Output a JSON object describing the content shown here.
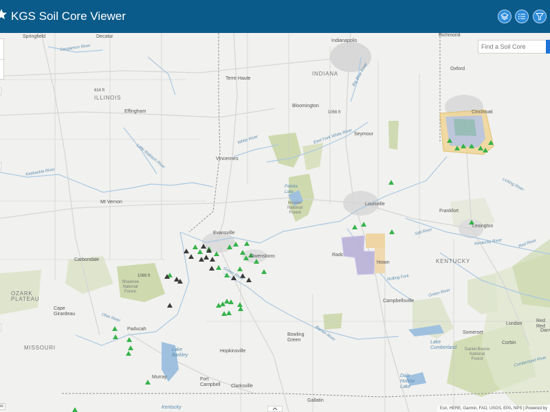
{
  "header": {
    "title": "KGS Soil Core Viewer",
    "icons": [
      "kgs-logo-icon",
      "layers-icon",
      "list-icon",
      "filter-icon"
    ]
  },
  "search": {
    "placeholder": "Find a Soil Core"
  },
  "map": {
    "labels": {
      "springfield": "Springfield",
      "decatur": "Decatur",
      "indianapolis": "Indianapolis",
      "richmond": "Richmond",
      "indiana": "INDIANA",
      "oxford": "Oxford",
      "terre_haute": "Terre Haute",
      "illinois": "ILLINOIS",
      "elev_814": "814 ft",
      "effingham": "Effingham",
      "bloomington": "Bloomington",
      "elev_1056": "1056 ft",
      "cincinnati": "Cincinnati",
      "seymour": "Seymour",
      "vincennes": "Vincennes",
      "mt_vernon": "Mt Vernon",
      "hoosier": "Hoosier\nNational\nForest",
      "louisville": "Louisville",
      "frankfort": "Frankfort",
      "lexington": "Lexington",
      "evansville": "Evansville",
      "owensboro": "Owensboro",
      "carbondale": "Carbondale",
      "radcliff_part": "Radc",
      "elizabethtown_part": "htown",
      "kentucky": "KENTUCKY",
      "elev_1069": "1069 ft",
      "shawnee": "Shawnee\nNational\nForest",
      "ozark": "OZARK\nPLATEAU",
      "cape_girardeau": "Cape\nGirardeau",
      "campbellsville": "Campbellsville",
      "london": "London",
      "paducah": "Paducah",
      "missouri": "MISSOURI",
      "somerset": "Somerset",
      "bowling_green": "Bowling\nGreen",
      "corbin": "Corbin",
      "daniel_boone": "Daniel Boone\nNational\nForest",
      "hopkinsville": "Hopkinsville",
      "lake_cumberland": "Lake\nCumberland",
      "lake_barkley": "Lake\nBarkley",
      "murray": "Murray",
      "fort_campbell": "Fort\nCampbell",
      "clarksville": "Clarksville",
      "dale_hollow": "Dale\nHollow\nLake",
      "gallatin": "Gallatin",
      "kentucky_lake": "Kentucky",
      "white_river": "White River",
      "east_fork": "East Fork White River",
      "big_blue": "Big Blue River",
      "little_wabash": "Little Wabash River",
      "kaskaskia": "Kaskaskia River",
      "sangamon": "Sangamon River",
      "green_river": "Green River",
      "salt_river": "Salt River",
      "rolling_fork": "Rolling Fork",
      "licking_river": "Licking River",
      "red_river": "Red River",
      "kentucky_river": "Kentucky River",
      "green_river_2": "Green River",
      "barren_river": "Barren River",
      "patoka_lake": "Patoka\nLake",
      "ohio_river": "Ohio River",
      "cumberland_river": "Cumberland River",
      "red_partial": "Red\nRed",
      "danville_partial": "Danv",
      "left_partial": "ni"
    },
    "attribution": "Esri, HERE, Garmin, FAO, USGS, EPA, NPS | Powered by"
  },
  "colors": {
    "header": "#0b5b8a",
    "accent": "#2b8bd9",
    "green_marker": "#35b24a",
    "dark_marker": "#3b3b3b",
    "forest": "#c8d5a2"
  }
}
